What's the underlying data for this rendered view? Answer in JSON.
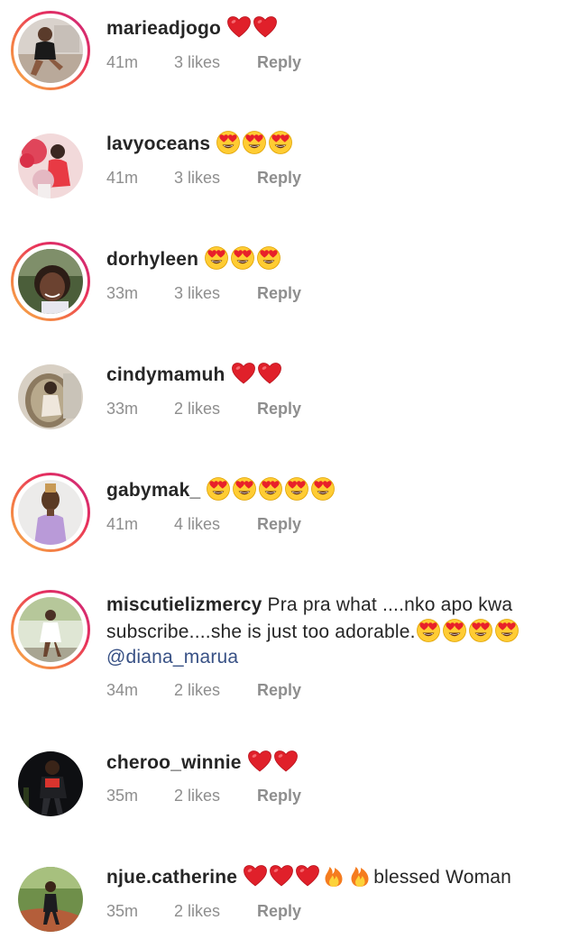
{
  "comments": [
    {
      "username": "marieadjogo",
      "emojis": [
        "heart",
        "heart"
      ],
      "text": "",
      "time": "41m",
      "likes": "3 likes",
      "reply": "Reply",
      "ring": true
    },
    {
      "username": "lavyoceans",
      "emojis": [
        "heart-eyes",
        "heart-eyes",
        "heart-eyes"
      ],
      "text": "",
      "time": "41m",
      "likes": "3 likes",
      "reply": "Reply",
      "ring": false
    },
    {
      "username": "dorhyleen",
      "emojis": [
        "heart-eyes",
        "heart-eyes",
        "heart-eyes"
      ],
      "text": "",
      "time": "33m",
      "likes": "3 likes",
      "reply": "Reply",
      "ring": true
    },
    {
      "username": "cindymamuh",
      "emojis": [
        "heart",
        "heart"
      ],
      "text": "",
      "time": "33m",
      "likes": "2 likes",
      "reply": "Reply",
      "ring": false
    },
    {
      "username": "gabymak_",
      "emojis": [
        "heart-eyes",
        "heart-eyes",
        "heart-eyes",
        "heart-eyes",
        "heart-eyes"
      ],
      "text": "",
      "time": "41m",
      "likes": "4 likes",
      "reply": "Reply",
      "ring": true
    },
    {
      "username": "miscutielizmercy",
      "text_line1": "Pra pra what ....nko apo kwa",
      "text_line2": "subscribe....she is just too adorable.",
      "emojis": [
        "heart-eyes",
        "heart-eyes",
        "heart-eyes",
        "heart-eyes"
      ],
      "mention": "@diana_marua",
      "time": "34m",
      "likes": "2 likes",
      "reply": "Reply",
      "ring": true
    },
    {
      "username": "cheroo_winnie",
      "emojis": [
        "heart",
        "heart"
      ],
      "text": "",
      "time": "35m",
      "likes": "2 likes",
      "reply": "Reply",
      "ring": false
    },
    {
      "username": "njue.catherine",
      "emojis": [
        "heart",
        "heart",
        "heart",
        "fire",
        "fire"
      ],
      "text": "blessed Woman",
      "time": "35m",
      "likes": "2 likes",
      "reply": "Reply",
      "ring": false
    }
  ],
  "colors": {
    "username": "#262626",
    "meta": "#8e8e8e",
    "mention": "#385185",
    "heart": "#e0202a",
    "ring_start": "#f7b24a",
    "ring_end": "#c8287f"
  }
}
